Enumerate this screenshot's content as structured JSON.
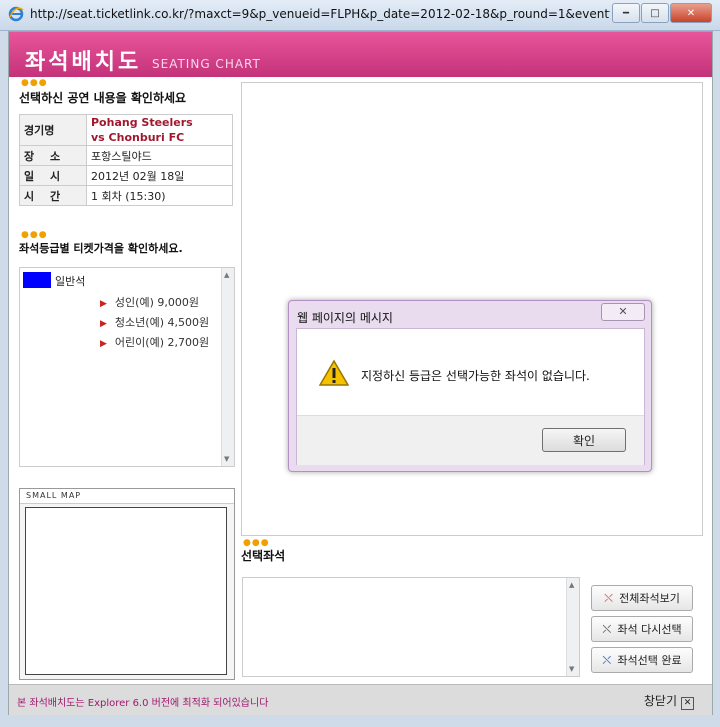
{
  "browser": {
    "url": "http://seat.ticketlink.co.kr/?maxct=9&p_venueid=FLPH&p_date=2012-02-18&p_round=1&eventtime=153..."
  },
  "header": {
    "title": "좌석배치도",
    "subtitle": "SEATING CHART"
  },
  "performance": {
    "section_title": "선택하신 공연 내용을 확인하세요",
    "rows": [
      {
        "label": "경기명",
        "value_line1": "Pohang Steelers",
        "value_line2": "vs Chonburi FC"
      },
      {
        "label": "장 소",
        "value": "포항스틸야드"
      },
      {
        "label": "일 시",
        "value": "2012년 02월 18일"
      },
      {
        "label": "시 간",
        "value": "1 회차 (15:30)"
      }
    ]
  },
  "prices": {
    "section_title": "좌석등급별 티켓가격을 확인하세요.",
    "grade_name": "일반석",
    "grade_color": "#0000ff",
    "items": [
      "성인(예) 9,000원",
      "청소년(예) 4,500원",
      "어린이(예) 2,700원"
    ]
  },
  "small_map": {
    "label": "SMALL MAP"
  },
  "selected": {
    "section_title": "선택좌석"
  },
  "buttons": {
    "view_all": "전체좌석보기",
    "reselect": "좌석 다시선택",
    "complete": "좌석선택 완료"
  },
  "footer": {
    "note": "본 좌석배치도는 Explorer 6.0 버전에 최적화 되어있습니다",
    "close": "창닫기"
  },
  "dialog": {
    "title": "웹 페이지의 메시지",
    "message": "지정하신 등급은 선택가능한 좌석이 없습니다.",
    "ok": "확인"
  }
}
